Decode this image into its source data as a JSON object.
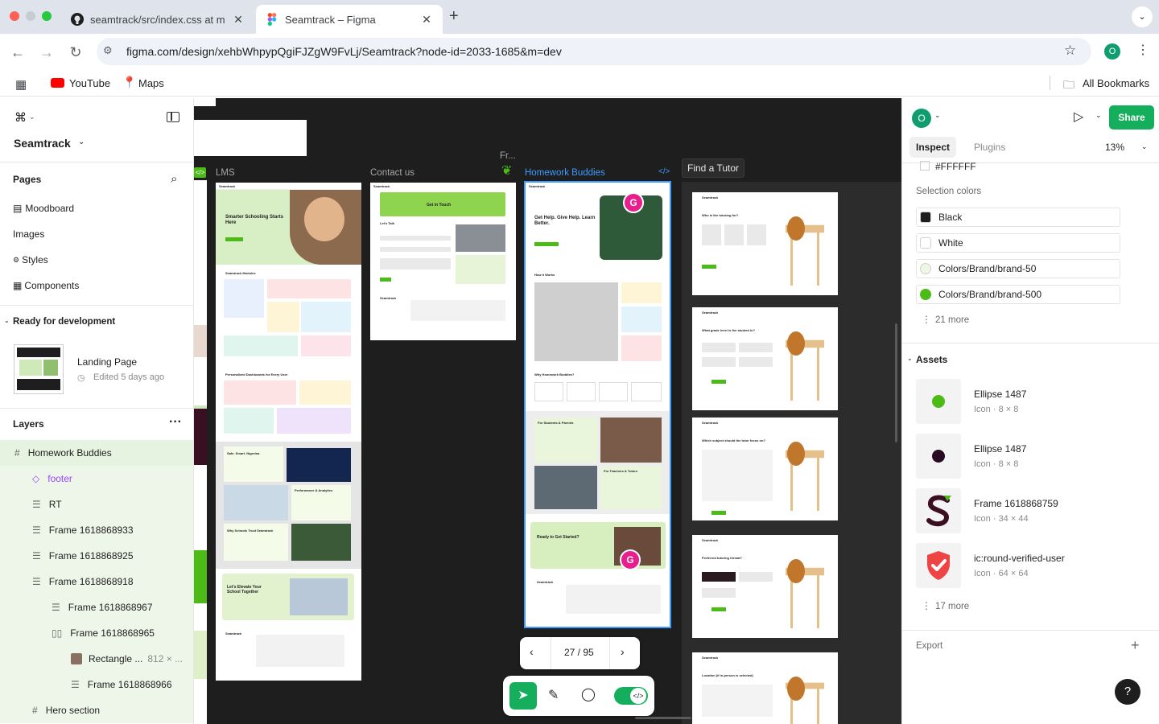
{
  "browser": {
    "tabs": [
      {
        "title": "seamtrack/src/index.css at m"
      },
      {
        "title": "Seamtrack – Figma"
      }
    ],
    "url": "figma.com/design/xehbWhpypQgiFJZgW9FvLj/Seamtrack?node-id=2033-1685&m=dev",
    "profile_initial": "O",
    "bookmarks": [
      "YouTube",
      "Maps"
    ],
    "all_bookmarks": "All Bookmarks"
  },
  "left_panel": {
    "file_name": "Seamtrack",
    "pages_title": "Pages",
    "pages": [
      "Moodboard",
      "Images",
      "Styles",
      "Components"
    ],
    "ready_title": "Ready for development",
    "ready_item": {
      "name": "Landing Page",
      "edited": "Edited 5 days ago"
    },
    "layers_title": "Layers",
    "layers": [
      {
        "label": "Homework Buddies"
      },
      {
        "label": "footer"
      },
      {
        "label": "RT"
      },
      {
        "label": "Frame 1618868933"
      },
      {
        "label": "Frame 1618868925"
      },
      {
        "label": "Frame 1618868918"
      },
      {
        "label": "Frame 1618868967"
      },
      {
        "label": "Frame 1618868965"
      },
      {
        "label": "Rectangle ...",
        "extra": "812 × ..."
      },
      {
        "label": "Frame 1618868966"
      },
      {
        "label": "Hero section"
      }
    ]
  },
  "canvas": {
    "labels": {
      "lms": "LMS",
      "contact": "Contact us",
      "homework": "Homework Buddies",
      "find_tutor": "Find a Tutor",
      "fr": "Fr..."
    },
    "pager": "27 / 95",
    "avatar_initial": "G",
    "lms_texts": {
      "hero": "Smarter Schooling Starts Here",
      "modules": "Seamtrack Modules",
      "dashboards": "Personalized Dashboards for Every User",
      "safe": "Safe. Smart. Nigerian.",
      "perf": "Performance & Analytics",
      "trust": "Why Schools Trust Seamtrack",
      "elevate": "Let's Elevate Your School Together"
    },
    "contact_texts": {
      "cta": "Get in Touch",
      "talk": "Let's Talk"
    },
    "hb_texts": {
      "hero": "Get Help. Give Help. Learn Better.",
      "how": "How it Works",
      "why": "Why Homework Buddies?",
      "students": "For Students & Parents",
      "teachers": "For Teachers & Tutors",
      "ready": "Ready to Get Started?"
    },
    "tutor_questions": [
      "Who is the tutoring for?",
      "What grade level is the student in?",
      "Which subject should the tutor focus on?",
      "Preferred tutoring format?",
      "Location (if in-person is selected)"
    ],
    "brand": "Seamtrack"
  },
  "right_panel": {
    "user_initial": "O",
    "share": "Share",
    "tabs": [
      "Inspect",
      "Plugins"
    ],
    "zoom": "13%",
    "top_color": "#FFFFFF",
    "selection_colors_title": "Selection colors",
    "selection_colors": [
      {
        "name": "Black",
        "hex": "#1e1e1e"
      },
      {
        "name": "White",
        "hex": "#ffffff"
      },
      {
        "name": "Colors/Brand/brand-50",
        "hex": "#eef7e6"
      },
      {
        "name": "Colors/Brand/brand-500",
        "hex": "#4cbb17"
      }
    ],
    "colors_more": "21 more",
    "assets_title": "Assets",
    "assets": [
      {
        "name": "Ellipse 1487",
        "sub": "Icon · 8 × 8",
        "icon": "green-dot-icon"
      },
      {
        "name": "Ellipse 1487",
        "sub": "Icon · 8 × 8",
        "icon": "dark-dot-icon"
      },
      {
        "name": "Frame 1618868759",
        "sub": "Icon · 34 × 44",
        "icon": "seamtrack-logo-icon"
      },
      {
        "name": "ic:round-verified-user",
        "sub": "Icon · 64 × 64",
        "icon": "verified-user-icon"
      }
    ],
    "assets_more": "17 more",
    "export_title": "Export",
    "help": "?"
  }
}
